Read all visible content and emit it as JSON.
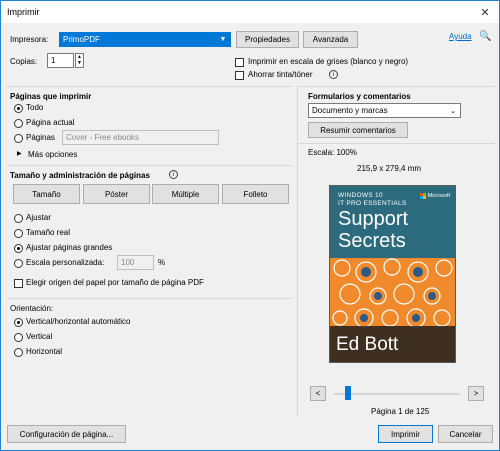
{
  "window": {
    "title": "Imprimir",
    "close_glyph": "✕"
  },
  "printer": {
    "label": "Impresora:",
    "value": "PrimoPDF",
    "properties_btn": "Propiedades",
    "advanced_btn": "Avanzada",
    "help_link": "Ayuda"
  },
  "copies": {
    "label": "Copias:",
    "value": "1"
  },
  "options": {
    "grayscale": "Imprimir en escala de grises (blanco y negro)",
    "save_ink": "Ahorrar tinta/tóner"
  },
  "pages": {
    "header": "Páginas que imprimir",
    "all": "Todo",
    "current": "Página actual",
    "pages": "Páginas",
    "pages_input": "Cover - Free ebooks",
    "more": "Más opciones"
  },
  "sizing": {
    "header": "Tamaño y administración de páginas",
    "buttons": [
      "Tamaño",
      "Póster",
      "Múltiple",
      "Folleto"
    ],
    "fit": "Ajustar",
    "actual": "Tamaño real",
    "shrink": "Ajustar páginas grandes",
    "custom": "Escala personalizada:",
    "custom_value": "100",
    "percent": "%",
    "paper_source": "Elegir origen del papel por tamaño de página PDF"
  },
  "orientation": {
    "header": "Orientación:",
    "auto": "Vertical/horizontal automático",
    "portrait": "Vertical",
    "landscape": "Horizontal"
  },
  "comments": {
    "header": "Formularios y comentarios",
    "value": "Documento y marcas",
    "summarize_btn": "Resumir comentarios"
  },
  "preview": {
    "scale": "Escala: 100%",
    "dimensions": "215,9 x 279,4 mm",
    "book_series": "WINDOWS 10\nIT PRO ESSENTIALS",
    "book_logo": "Microsoft",
    "book_title_1": "Support",
    "book_title_2": "Secrets",
    "book_author": "Ed Bott",
    "prev": "<",
    "next": ">",
    "page_info": "Página 1 de 125"
  },
  "footer": {
    "page_setup_btn": "Configuración de página...",
    "print_btn": "Imprimir",
    "cancel_btn": "Cancelar"
  },
  "colors": {
    "accent": "#0078d7",
    "book_teal": "#2c6a7e",
    "book_orange": "#f08a2c"
  }
}
